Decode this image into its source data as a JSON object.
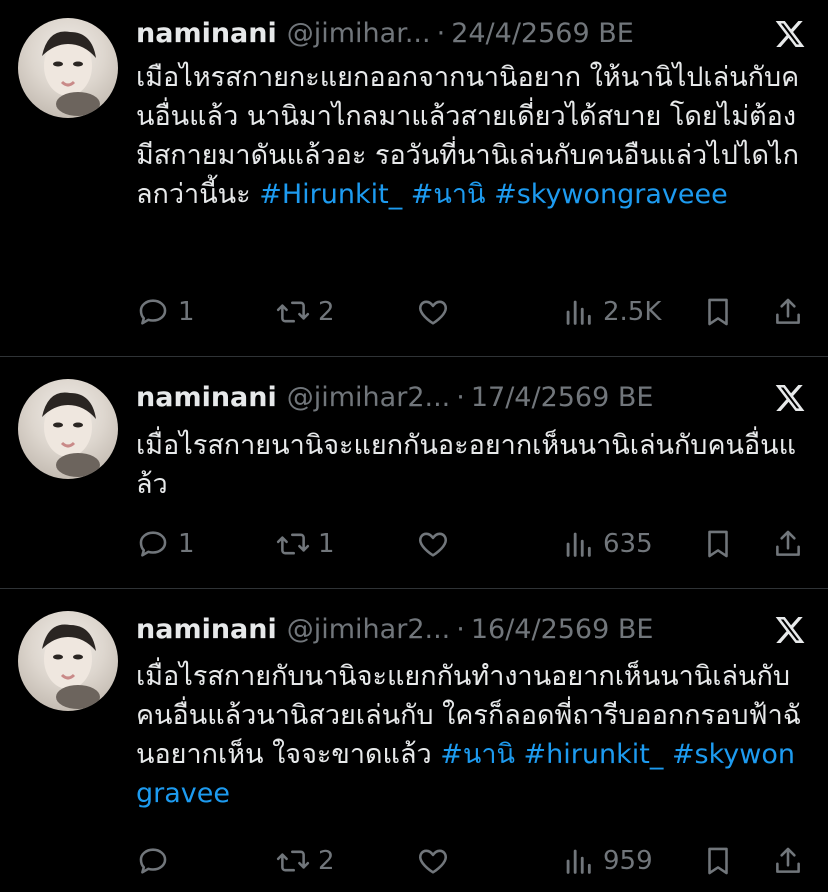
{
  "tweets": [
    {
      "name": "naminani",
      "handle": "@jimihar...",
      "dot": "·",
      "date": "24/4/2569 BE",
      "text": "เมือไหรสกายกะแยกออกจากนานิอยาก ให้นานิไปเล่นกับคนอื่นแล้ว นานิมาไกลมาแล้วสายเดี่ยวได้สบาย โดยไม่ต้องมีสกายมาดันแล้วอะ รอวันที่นานิเล่นกับคนอืนแล่วไปไดไกลกว่านี้นะ ",
      "hashtags": [
        "#Hirunkit_",
        "#นานิ",
        "#skywongraveee"
      ],
      "replies": "1",
      "retweets": "2",
      "likes": "",
      "views": "2.5K"
    },
    {
      "name": "naminani",
      "handle": "@jimihar2...",
      "dot": "·",
      "date": "17/4/2569 BE",
      "text": "เมื่อไรสกายนานิจะแยกกันอะอยากเห็นนานิเล่นกับคนอื่นแล้ว",
      "hashtags": [],
      "replies": "1",
      "retweets": "1",
      "likes": "",
      "views": "635"
    },
    {
      "name": "naminani",
      "handle": "@jimihar2...",
      "dot": "·",
      "date": "16/4/2569 BE",
      "text": "เมื่อไรสกายกับนานิจะแยกกันทำงานอยากเห็นนานิเล่นกับคนอื่นแล้วนานิสวยเล่นกับ ใครก็ลอดพี่ถารีบออกกรอบฟ้าฉันอยากเห็น ใจจะขาดแล้ว ",
      "hashtags": [
        "#นานิ",
        "#hirunkit_",
        "#skywongravee"
      ],
      "replies": "",
      "retweets": "2",
      "likes": "",
      "views": "959"
    }
  ],
  "icons": {
    "reply": "speech-bubble-icon",
    "retweet": "retweet-arrows-icon",
    "like": "heart-icon",
    "views": "bar-chart-icon",
    "bookmark": "bookmark-icon",
    "share": "share-upload-icon",
    "platform": "x-logo-icon"
  },
  "colors": {
    "background": "#000000",
    "text": "#e7e9ea",
    "muted": "#71767b",
    "hashtag": "#1d9bf0",
    "divider": "#2f3336"
  }
}
